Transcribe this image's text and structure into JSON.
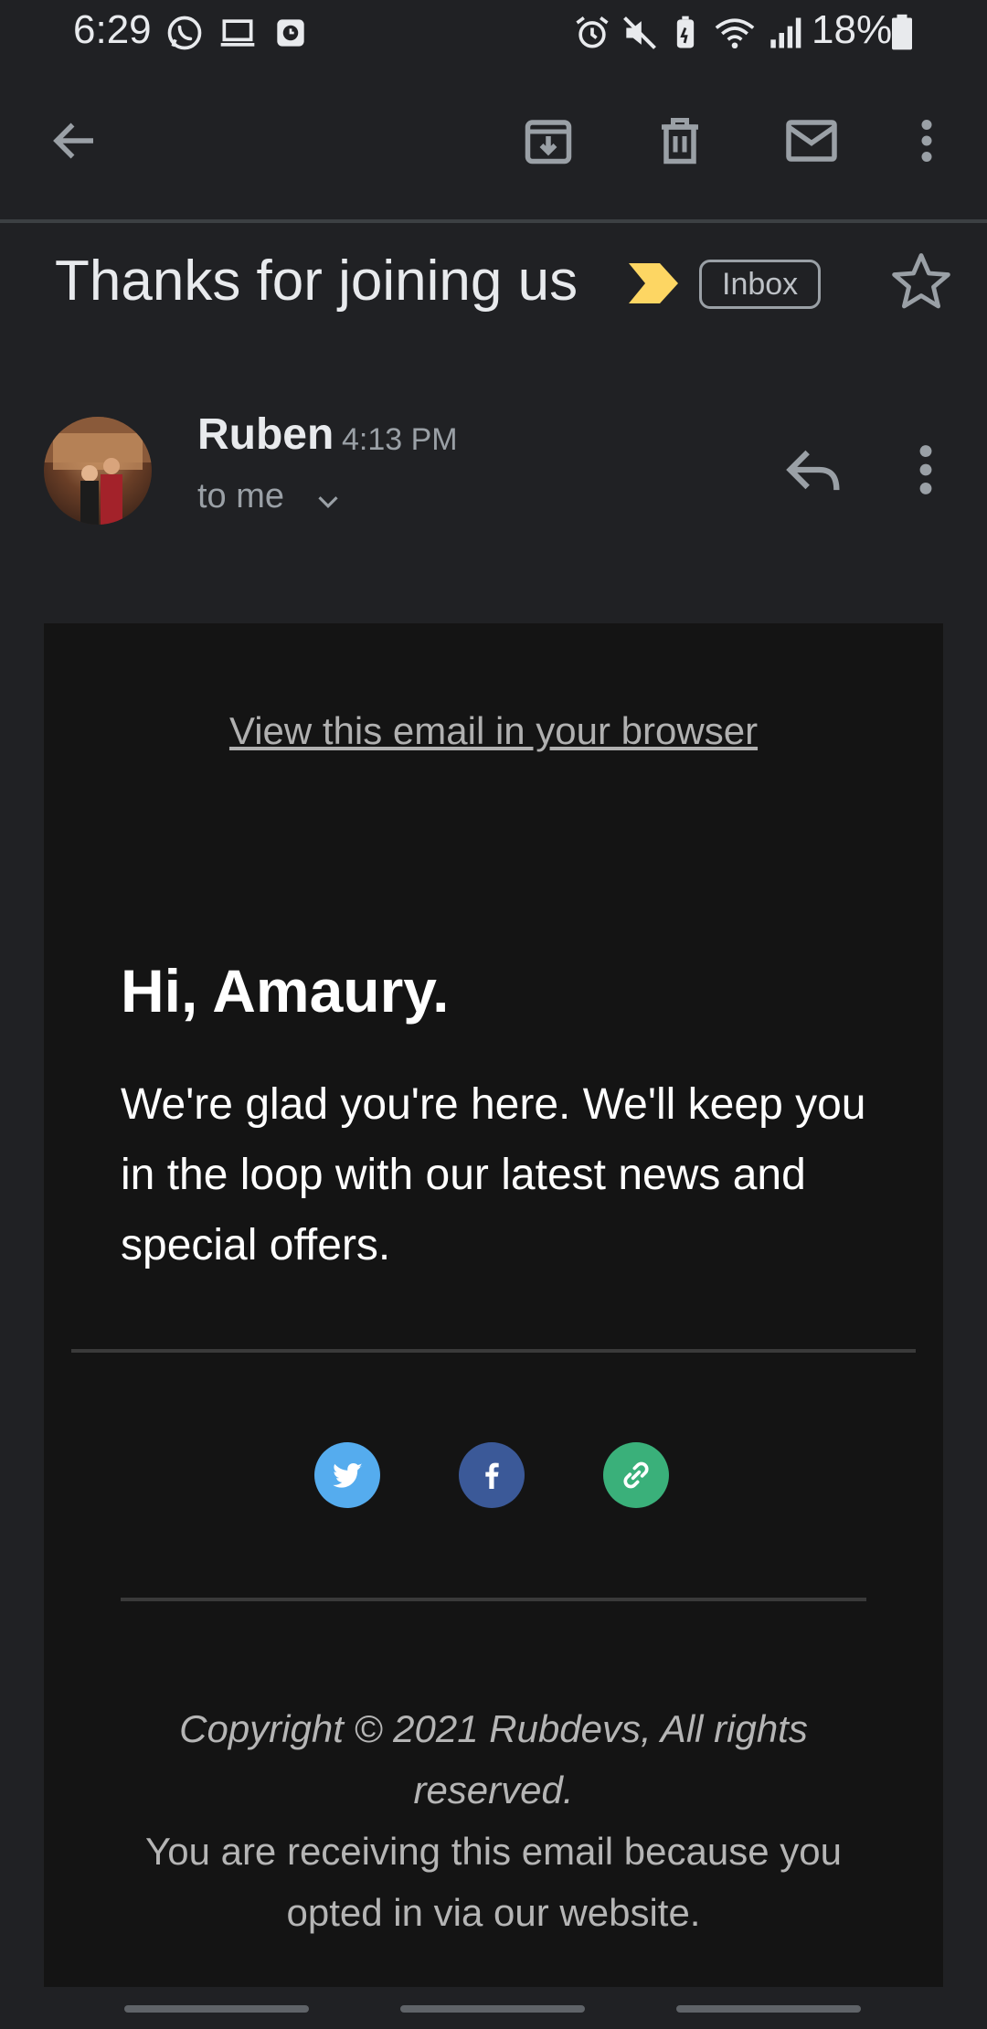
{
  "status_bar": {
    "time": "6:29",
    "battery": "18%",
    "left_icons": [
      "whatsapp-icon",
      "laptop-icon",
      "clock-app-icon"
    ],
    "right_icons": [
      "alarm-icon",
      "mute-icon",
      "battery-saver-icon",
      "wifi-icon",
      "signal-icon",
      "battery-icon"
    ]
  },
  "toolbar": {
    "back": "arrow-left-icon",
    "archive": "archive-icon",
    "delete": "trash-icon",
    "mark_unread": "mail-icon",
    "more": "more-vertical-icon"
  },
  "email": {
    "subject": "Thanks for joining us",
    "label": "Inbox",
    "importance_color": "#fdd663",
    "sender": "Ruben",
    "time": "4:13 PM",
    "recipient": "to me"
  },
  "content": {
    "view_in_browser": "View this email in your browser",
    "greeting": "Hi, Amaury.",
    "body": "We're glad you're here. We'll keep you in the loop with our latest news and special offers.",
    "social": [
      {
        "name": "twitter-icon",
        "color": "#55acee"
      },
      {
        "name": "facebook-icon",
        "color": "#3b5998"
      },
      {
        "name": "link-icon",
        "color": "#3ab07a"
      }
    ],
    "copyright": "Copyright © 2021 Rubdevs, All rights reserved.",
    "receiving": "You are receiving this email because you opted in via our website."
  },
  "colors": {
    "background": "#202124",
    "email_body_bg": "#141414",
    "text_primary": "#e8eaed",
    "text_secondary": "#9aa0a6"
  }
}
